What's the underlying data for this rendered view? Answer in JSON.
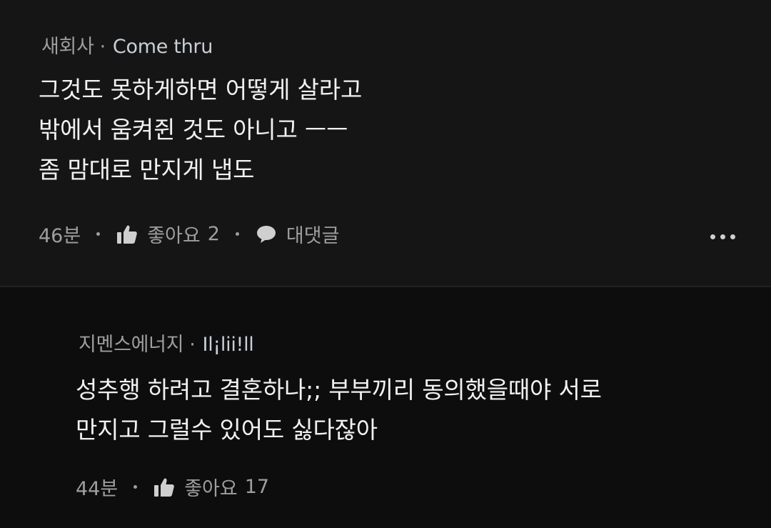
{
  "comments": [
    {
      "author": "새회사",
      "badge": "Come thru",
      "lines": [
        "그것도 못하게하면 어떻게 살라고",
        "밖에서 움켜쥔 것도 아니고 ㅡㅡ",
        "좀 맘대로 만지게 냅도"
      ],
      "time": "46분",
      "like_label": "좋아요",
      "like_count": "2",
      "reply_label": "대댓글"
    },
    {
      "author": "지멘스에너지",
      "badge": "Il¡lii!ll",
      "lines": [
        "성추행 하려고 결혼하나;; 부부끼리 동의했을때야 서로",
        "만지고 그럴수 있어도 싫다잖아"
      ],
      "time": "44분",
      "like_label": "좋아요",
      "like_count": "17"
    }
  ],
  "icons": {
    "like": "thumbs-up-icon",
    "reply": "speech-bubble-icon",
    "more": "more-horizontal-icon"
  },
  "colors": {
    "background": "#0d0d0d",
    "card": "#151515",
    "text": "#f1f1f1",
    "muted": "#9e9e9e"
  }
}
